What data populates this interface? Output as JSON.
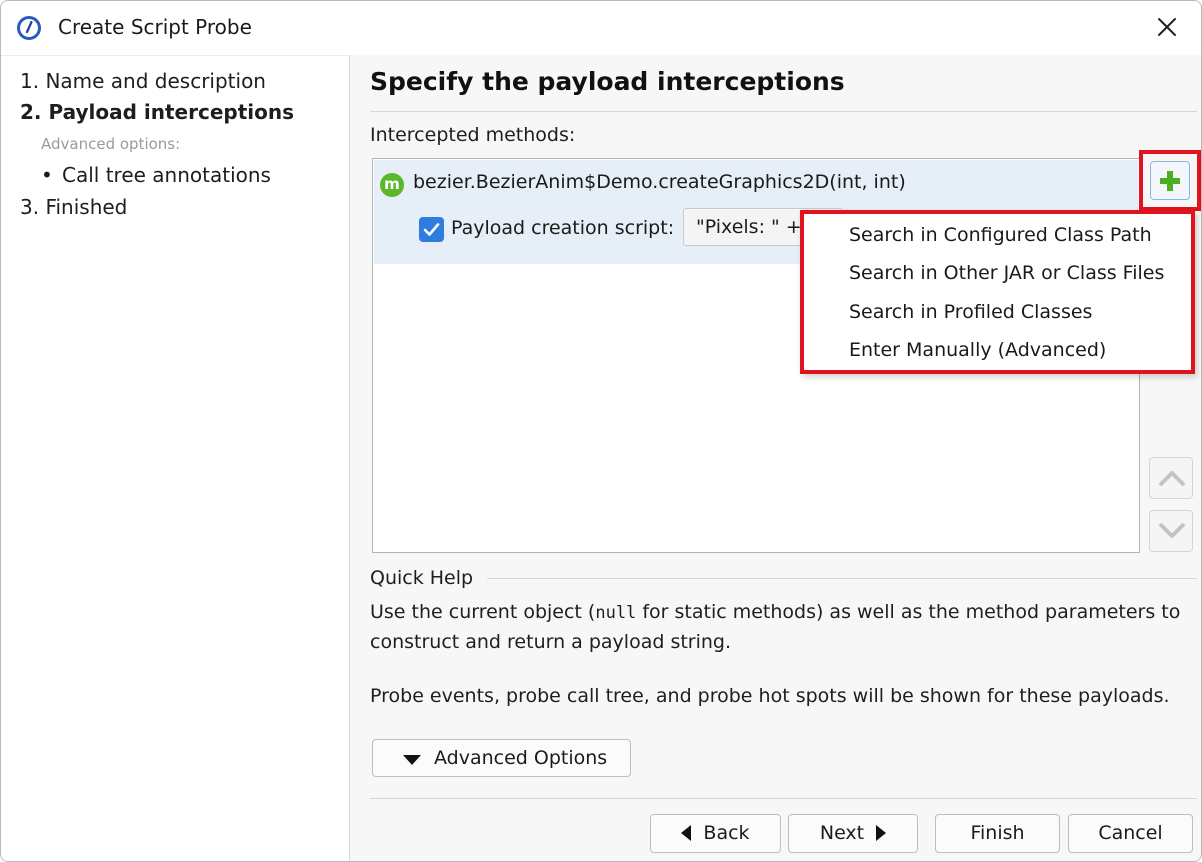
{
  "window": {
    "title": "Create Script Probe",
    "app_icon": "profiler-gauge-icon",
    "close_icon": "close-icon"
  },
  "steps": {
    "items": [
      {
        "label": "1. Name and description",
        "current": false
      },
      {
        "label": "2. Payload interceptions",
        "current": true
      },
      {
        "label": "3. Finished",
        "current": false
      }
    ],
    "advanced_label": "Advanced options:",
    "advanced_bullet": "•",
    "advanced_item": "Call tree annotations"
  },
  "main": {
    "heading": "Specify the payload interceptions",
    "methods_label": "Intercepted methods:",
    "method": {
      "icon_letter": "m",
      "signature": "bezier.BezierAnim$Demo.createGraphics2D(int, int)",
      "checkbox_checked": true,
      "script_label": "Payload creation script:",
      "script_value": "\"Pixels: \" +"
    },
    "add_icon": "plus-icon",
    "add_menu": [
      "Search in Configured Class Path",
      "Search in Other JAR or Class Files",
      "Search in Profiled Classes",
      "Enter Manually (Advanced)"
    ],
    "move_up_icon": "chevron-up-icon",
    "move_down_icon": "chevron-down-icon"
  },
  "quick_help": {
    "title": "Quick Help",
    "line1_pre": "Use the current object (",
    "line1_code": "null",
    "line1_post": " for static methods) as well as the method parameters to",
    "line2": "construct and return a payload string.",
    "line3": "Probe events, probe call tree, and probe hot spots will be shown for these payloads."
  },
  "advanced_button": "Advanced Options",
  "footer": {
    "back": "Back",
    "next": "Next",
    "finish": "Finish",
    "cancel": "Cancel"
  },
  "colors": {
    "highlight": "#e0141e",
    "selection": "#e6eef7",
    "checkbox": "#2f7ce0",
    "method_icon": "#5bb82a",
    "plus": "#4caf22"
  }
}
